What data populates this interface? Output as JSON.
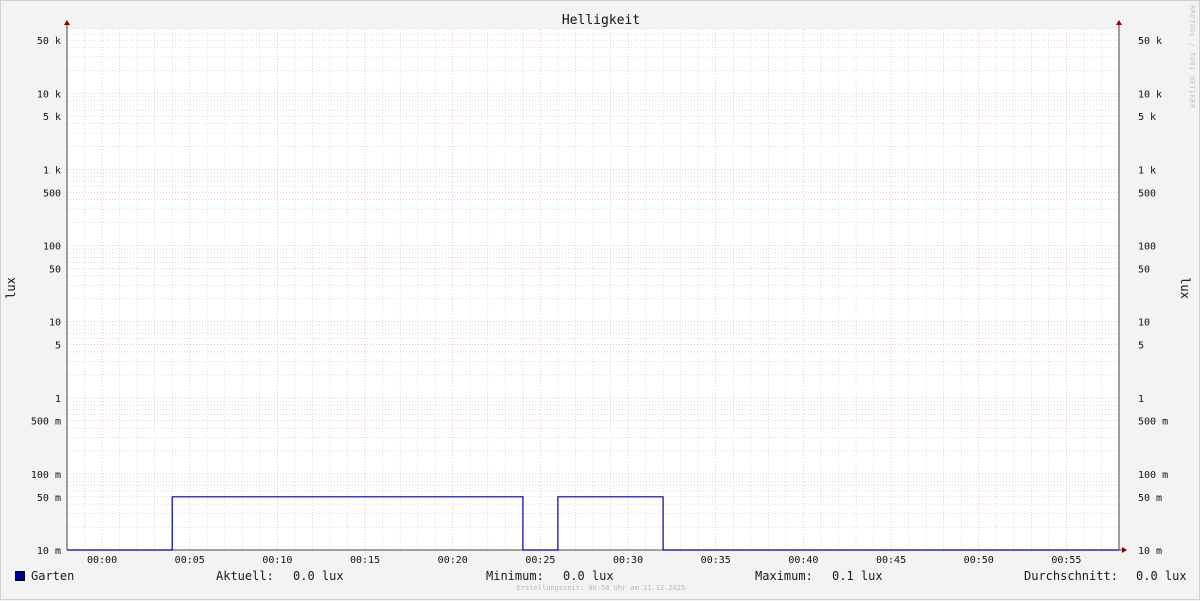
{
  "chart_data": {
    "type": "line",
    "title": "Helligkeit",
    "ylabel": "lux",
    "y_scale": "log",
    "ylim": [
      0.01,
      70000
    ],
    "y_ticks": [
      {
        "value": 50000,
        "label": "50 k"
      },
      {
        "value": 10000,
        "label": "10 k"
      },
      {
        "value": 5000,
        "label": "5 k"
      },
      {
        "value": 1000,
        "label": "1 k"
      },
      {
        "value": 500,
        "label": "500"
      },
      {
        "value": 100,
        "label": "100"
      },
      {
        "value": 50,
        "label": "50"
      },
      {
        "value": 10,
        "label": "10"
      },
      {
        "value": 5,
        "label": "5"
      },
      {
        "value": 1,
        "label": "1"
      },
      {
        "value": 0.5,
        "label": "500 m"
      },
      {
        "value": 0.1,
        "label": "100 m"
      },
      {
        "value": 0.05,
        "label": "50 m"
      },
      {
        "value": 0.01,
        "label": "10 m"
      }
    ],
    "x_ticks": [
      "00:00",
      "00:05",
      "00:10",
      "00:15",
      "00:20",
      "00:25",
      "00:30",
      "00:35",
      "00:40",
      "00:45",
      "00:50",
      "00:55"
    ],
    "xlim": [
      "23:58",
      "00:58"
    ],
    "grid": true,
    "series": [
      {
        "name": "Garten",
        "color": "#00009c",
        "x": [
          "23:58",
          "00:04",
          "00:04",
          "00:24",
          "00:24",
          "00:26",
          "00:26",
          "00:32",
          "00:32",
          "00:58"
        ],
        "y": [
          0.01,
          0.01,
          0.05,
          0.05,
          0.01,
          0.01,
          0.05,
          0.05,
          0.01,
          0.01
        ]
      }
    ]
  },
  "legend": {
    "series_name": "Garten",
    "current_label": "Aktuell:",
    "current_value": "0.0 lux",
    "min_label": "Minimum:",
    "min_value": "0.0 lux",
    "max_label": "Maximum:",
    "max_value": "0.1 lux",
    "avg_label": "Durchschnitt:",
    "avg_value": "0.0 lux"
  },
  "watermark": "RRDTOOL / TOBI OETIKER",
  "footer": "Erstellungszeit: 00:58 Uhr am 11.12.2025",
  "colors": {
    "background": "#f3f3f3",
    "plot_background": "#ffffff",
    "major_grid": "#e8a0a0",
    "minor_grid": "#c8c8c8",
    "series": "#00009c",
    "arrow": "#8b0000"
  }
}
